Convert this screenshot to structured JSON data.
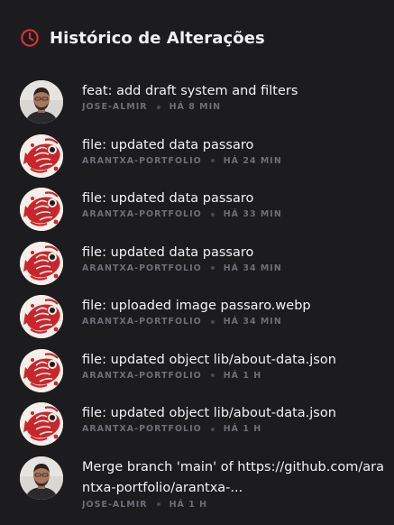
{
  "header": {
    "title": "Histórico de Alterações",
    "icon": "clock-icon",
    "accent": "#d0343a"
  },
  "commits": [
    {
      "message": "feat: add draft system and filters",
      "author": "JOSE-ALMIR",
      "time": "HÁ 8 MIN",
      "avatar": "person"
    },
    {
      "message": "file: updated data passaro",
      "author": "ARANTXA-PORTFOLIO",
      "time": "HÁ 24 MIN",
      "avatar": "red-fish"
    },
    {
      "message": "file: updated data passaro",
      "author": "ARANTXA-PORTFOLIO",
      "time": "HÁ 33 MIN",
      "avatar": "red-fish"
    },
    {
      "message": "file: updated data passaro",
      "author": "ARANTXA-PORTFOLIO",
      "time": "HÁ 34 MIN",
      "avatar": "red-fish"
    },
    {
      "message": "file: uploaded image passaro.webp",
      "author": "ARANTXA-PORTFOLIO",
      "time": "HÁ 34 MIN",
      "avatar": "red-fish"
    },
    {
      "message": "file: updated object lib/about-data.json",
      "author": "ARANTXA-PORTFOLIO",
      "time": "HÁ 1 H",
      "avatar": "red-fish"
    },
    {
      "message": "file: updated object lib/about-data.json",
      "author": "ARANTXA-PORTFOLIO",
      "time": "HÁ 1 H",
      "avatar": "red-fish"
    },
    {
      "message": "Merge branch 'main' of https://github.com/arantxa-portfolio/arantxa-...",
      "author": "JOSE-ALMIR",
      "time": "HÁ 1 H",
      "avatar": "person"
    }
  ]
}
